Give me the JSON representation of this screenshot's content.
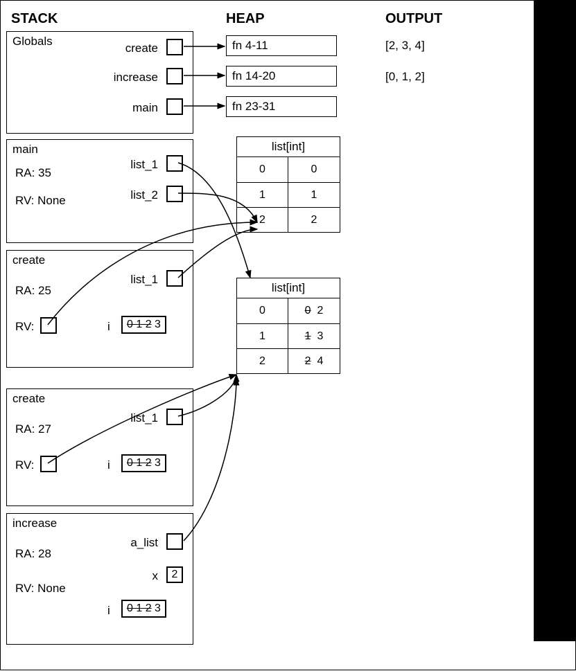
{
  "headers": {
    "stack": "STACK",
    "heap": "HEAP",
    "output": "OUTPUT"
  },
  "stack": {
    "globals": {
      "title": "Globals",
      "vars": {
        "create": "create",
        "increase": "increase",
        "main": "main"
      }
    },
    "main": {
      "title": "main",
      "ra": "RA: 35",
      "rv": "RV: None",
      "vars": {
        "list_1": "list_1",
        "list_2": "list_2"
      }
    },
    "create1": {
      "title": "create",
      "ra": "RA: 25",
      "rv_label": "RV:",
      "vars": {
        "list_1": "list_1",
        "i": "i",
        "i_seq_struck": "0  1  2",
        "i_seq_final": "3"
      }
    },
    "create2": {
      "title": "create",
      "ra": "RA: 27",
      "rv_label": "RV:",
      "vars": {
        "list_1": "list_1",
        "i": "i",
        "i_seq_struck": "0  1  2",
        "i_seq_final": "3"
      }
    },
    "increase": {
      "title": "increase",
      "ra": "RA: 28",
      "rv": "RV: None",
      "vars": {
        "a_list": "a_list",
        "x": "x",
        "x_val": "2",
        "i": "i",
        "i_seq_struck": "0  1  2",
        "i_seq_final": "3"
      }
    }
  },
  "heap": {
    "fn_create": "fn 4-11",
    "fn_increase": "fn 14-20",
    "fn_main": "fn 23-31",
    "list1": {
      "title": "list[int]",
      "rows": [
        {
          "idx": "0",
          "val": "0"
        },
        {
          "idx": "1",
          "val": "1"
        },
        {
          "idx": "2",
          "val": "2"
        }
      ]
    },
    "list2": {
      "title": "list[int]",
      "rows": [
        {
          "idx": "0",
          "old": "0",
          "new": "2"
        },
        {
          "idx": "1",
          "old": "1",
          "new": "3"
        },
        {
          "idx": "2",
          "old": "2",
          "new": "4"
        }
      ]
    }
  },
  "output": {
    "line1": "[2, 3, 4]",
    "line2": "[0, 1, 2]"
  }
}
